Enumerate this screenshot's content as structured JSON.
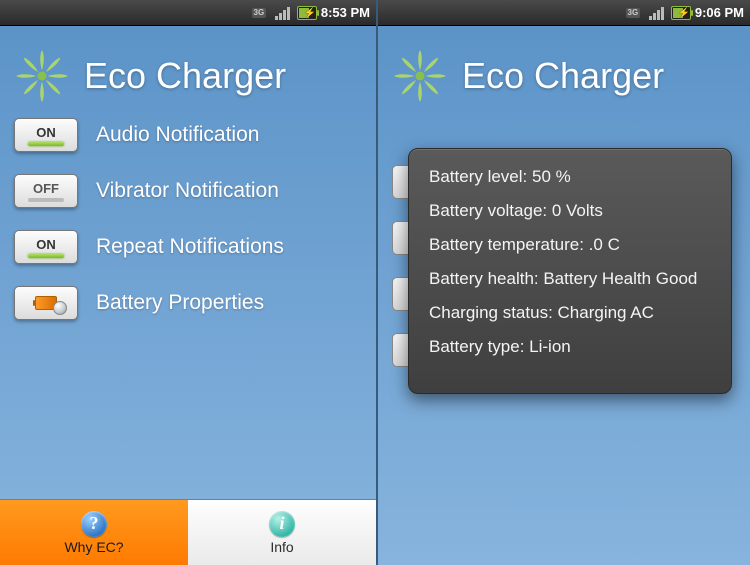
{
  "left": {
    "status": {
      "network": "3G",
      "time": "8:53 PM"
    },
    "header": {
      "title": "Eco Charger"
    },
    "settings": [
      {
        "state": "ON",
        "label": "Audio Notification"
      },
      {
        "state": "OFF",
        "label": "Vibrator Notification"
      },
      {
        "state": "ON",
        "label": "Repeat Notifications"
      },
      {
        "type": "icon",
        "label": "Battery Properties"
      }
    ],
    "tabs": [
      {
        "label": "Why EC?",
        "active": true,
        "icon": "?"
      },
      {
        "label": "Info",
        "active": false,
        "icon": "i"
      }
    ]
  },
  "right": {
    "status": {
      "network": "3G",
      "time": "9:06 PM"
    },
    "header": {
      "title": "Eco Charger"
    },
    "panel": {
      "lines": [
        "Battery level: 50 %",
        "Battery voltage: 0 Volts",
        "Battery temperature: .0 C",
        "Battery health: Battery Health Good",
        "Charging status:  Charging AC",
        "Battery type: Li-ion"
      ]
    }
  }
}
